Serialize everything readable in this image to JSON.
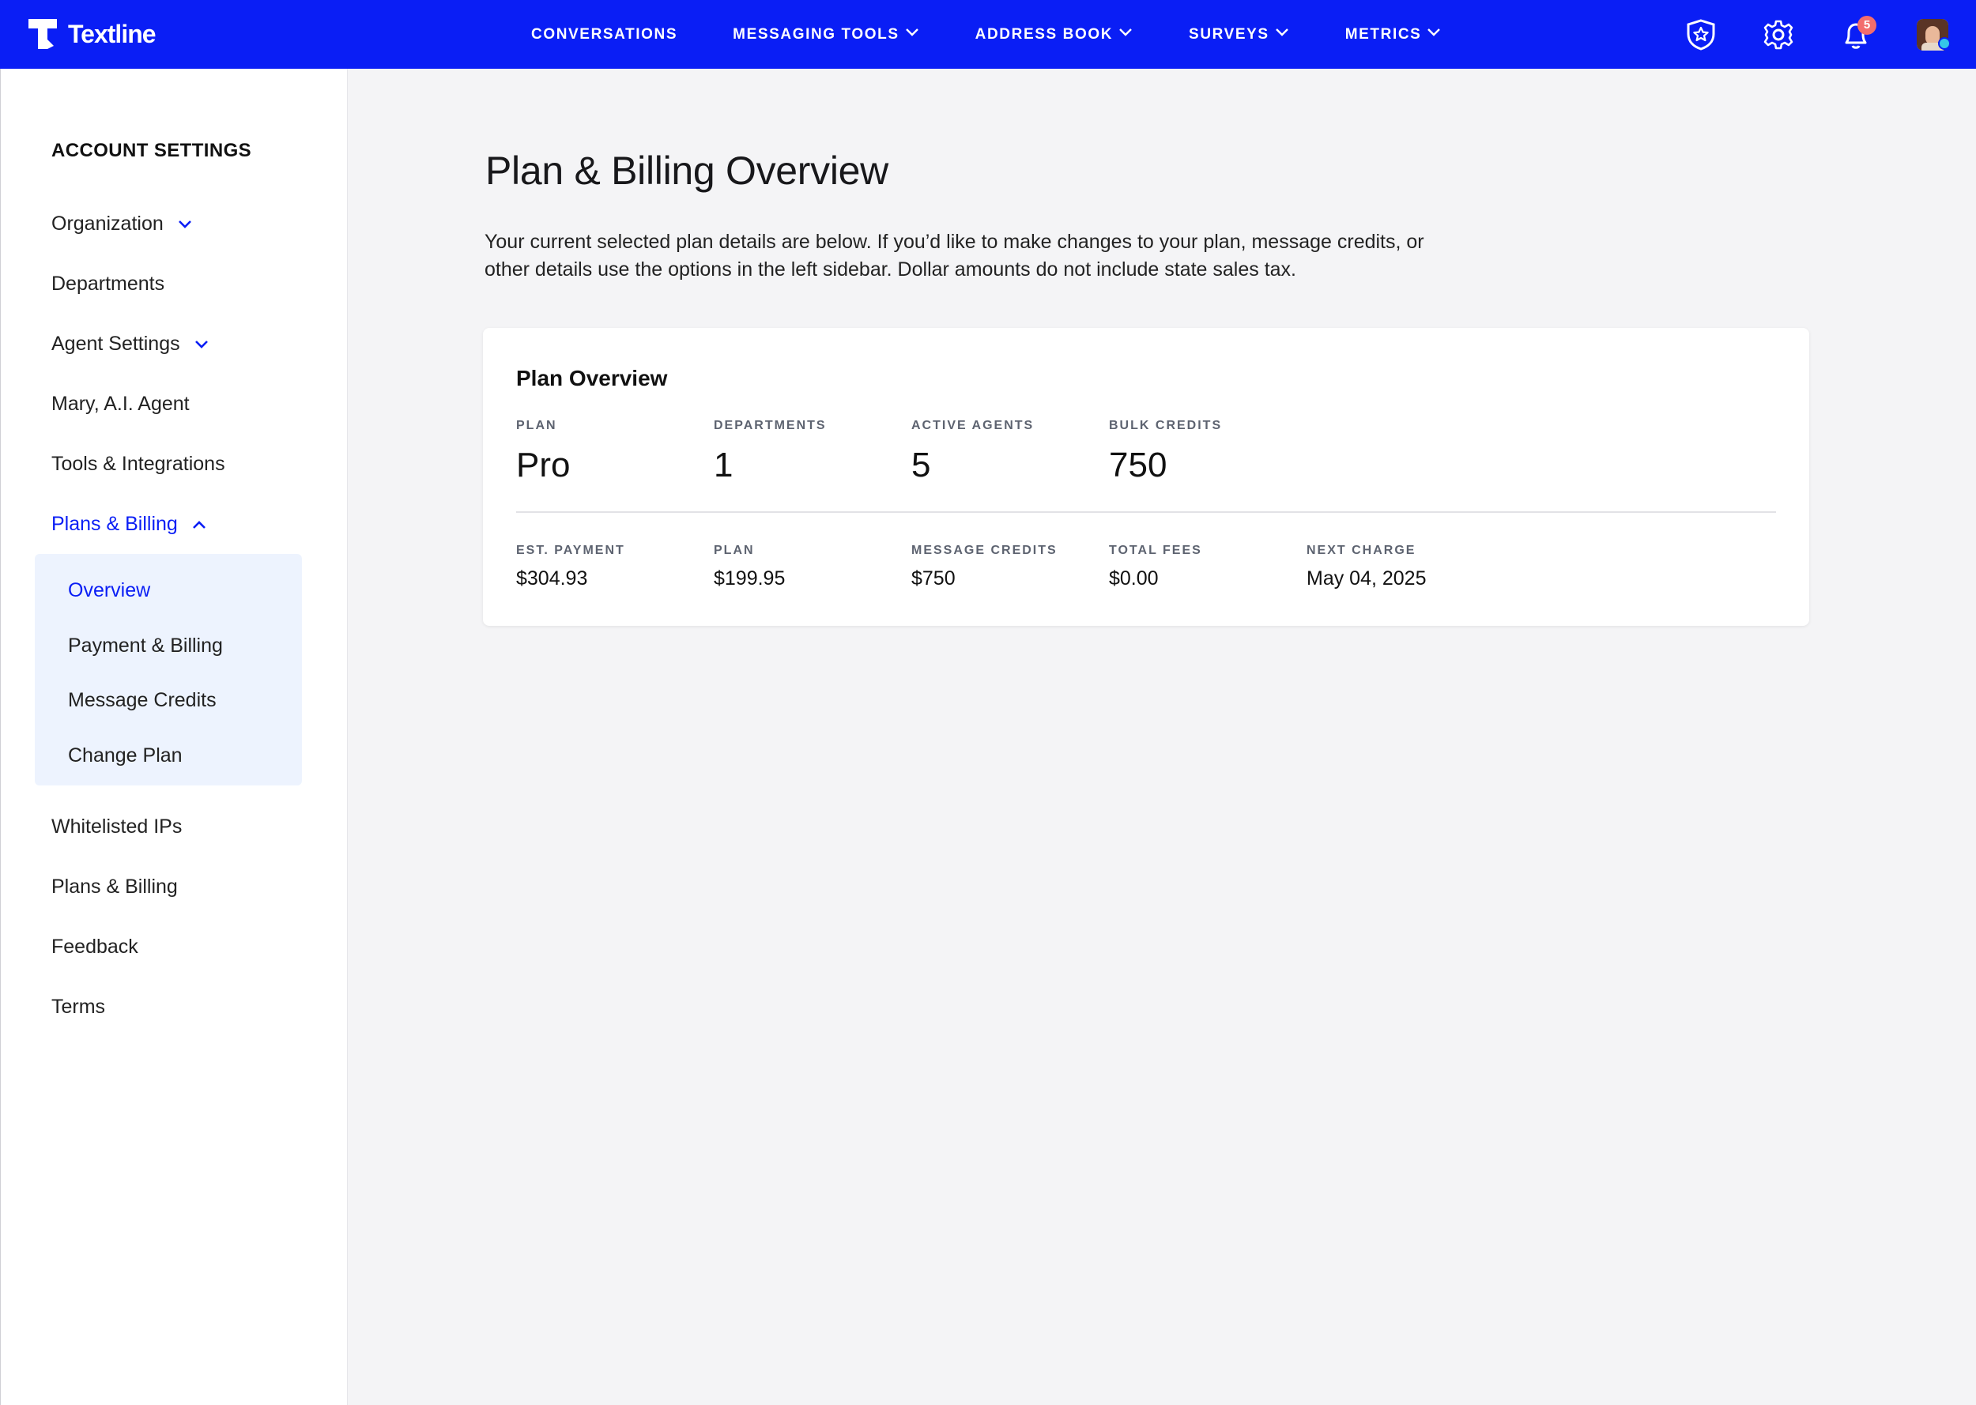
{
  "brand": {
    "name": "Textline"
  },
  "nav": {
    "items": [
      {
        "label": "CONVERSATIONS"
      },
      {
        "label": "MESSAGING TOOLS"
      },
      {
        "label": "ADDRESS BOOK"
      },
      {
        "label": "SURVEYS"
      },
      {
        "label": "METRICS"
      }
    ],
    "notifications_count": "5"
  },
  "sidebar": {
    "heading": "ACCOUNT SETTINGS",
    "items": [
      {
        "label": "Organization"
      },
      {
        "label": "Departments"
      },
      {
        "label": "Agent Settings"
      },
      {
        "label": "Mary, A.I. Agent"
      },
      {
        "label": "Tools & Integrations"
      },
      {
        "label": "Plans & Billing"
      },
      {
        "label": "Whitelisted IPs"
      },
      {
        "label": "Plans & Billing"
      },
      {
        "label": "Feedback"
      },
      {
        "label": "Terms"
      }
    ],
    "submenu": [
      {
        "label": "Overview"
      },
      {
        "label": "Payment & Billing"
      },
      {
        "label": "Message Credits"
      },
      {
        "label": "Change Plan"
      }
    ]
  },
  "main": {
    "title": "Plan & Billing Overview",
    "intro_line1": "Your current selected plan details are below. If you’d like to make changes to your plan, message credits, or",
    "intro_line2": "other details use the options in the left sidebar. Dollar amounts do not include state sales tax.",
    "card": {
      "title": "Plan Overview",
      "top_metrics": [
        {
          "label": "PLAN",
          "value": "Pro"
        },
        {
          "label": "DEPARTMENTS",
          "value": "1"
        },
        {
          "label": "ACTIVE AGENTS",
          "value": "5"
        },
        {
          "label": "BULK CREDITS",
          "value": "750"
        }
      ],
      "bottom_metrics": [
        {
          "label": "EST. PAYMENT",
          "value": "$304.93"
        },
        {
          "label": "PLAN",
          "value": "$199.95"
        },
        {
          "label": "MESSAGE CREDITS",
          "value": "$750"
        },
        {
          "label": "TOTAL FEES",
          "value": "$0.00"
        },
        {
          "label": "NEXT CHARGE",
          "value": "May 04, 2025"
        }
      ]
    }
  },
  "colors": {
    "brand_blue": "#0a1ef5",
    "badge_red": "#f26d6d",
    "online_cyan": "#35c6e8",
    "submenu_bg": "#edf3fe"
  }
}
